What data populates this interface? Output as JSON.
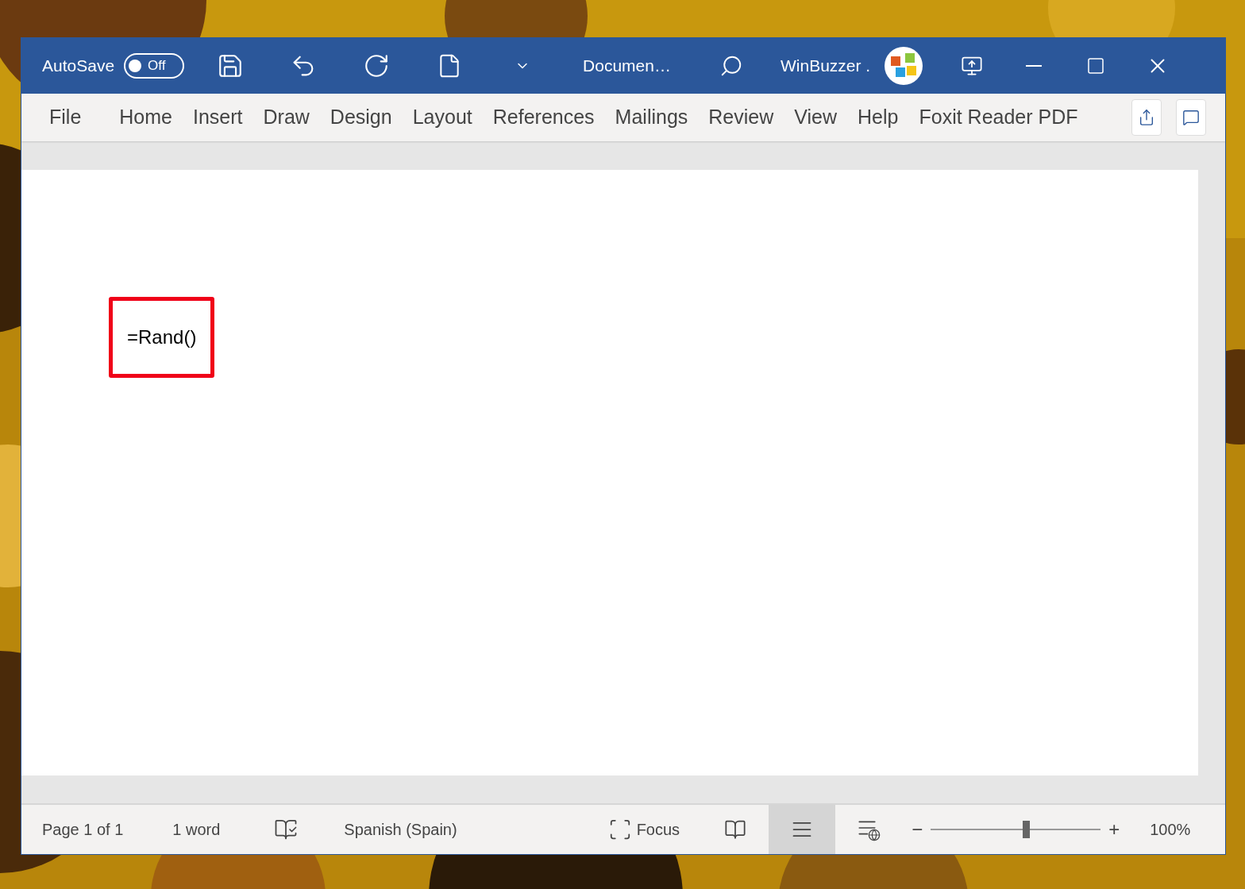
{
  "title_bar": {
    "autosave": {
      "label": "AutoSave",
      "on": false,
      "state_text": "Off"
    },
    "document_title": "Documen…",
    "user_name": "WinBuzzer ."
  },
  "ribbon_tabs": [
    {
      "label": "File"
    },
    {
      "label": "Home"
    },
    {
      "label": "Insert"
    },
    {
      "label": "Draw"
    },
    {
      "label": "Design"
    },
    {
      "label": "Layout"
    },
    {
      "label": "References"
    },
    {
      "label": "Mailings"
    },
    {
      "label": "Review"
    },
    {
      "label": "View"
    },
    {
      "label": "Help"
    },
    {
      "label": "Foxit Reader PDF"
    }
  ],
  "document": {
    "text": "=Rand()"
  },
  "status_bar": {
    "page": "Page 1 of 1",
    "words": "1 word",
    "language": "Spanish (Spain)",
    "focus": "Focus",
    "views": [
      {
        "kind": "read",
        "selected": false
      },
      {
        "kind": "print",
        "selected": true
      },
      {
        "kind": "web",
        "selected": false
      }
    ],
    "zoom": {
      "minus": "−",
      "plus": "+",
      "level": 0.56,
      "reading": "100%"
    }
  }
}
